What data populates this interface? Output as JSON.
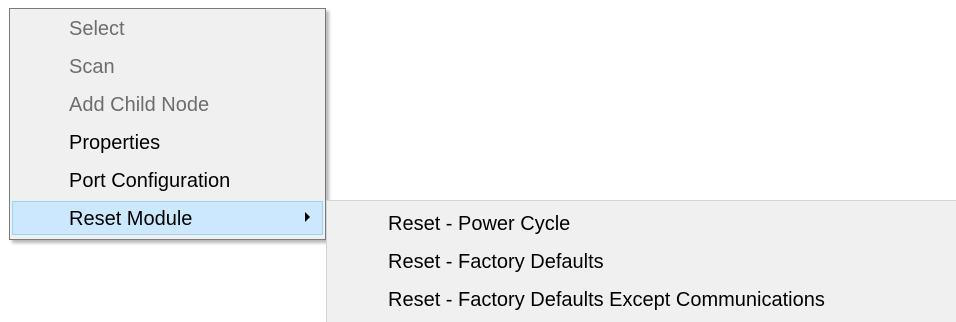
{
  "context_menu": {
    "items": [
      {
        "label": "Select",
        "enabled": false
      },
      {
        "label": "Scan",
        "enabled": false
      },
      {
        "label": "Add Child Node",
        "enabled": false
      },
      {
        "label": "Properties",
        "enabled": true
      },
      {
        "label": "Port Configuration",
        "enabled": true
      },
      {
        "label": "Reset Module",
        "enabled": true,
        "highlighted": true,
        "has_submenu": true
      }
    ],
    "submenu_arrow_icon": "chevron-right-icon"
  },
  "submenu": {
    "items": [
      {
        "label": "Reset - Power Cycle"
      },
      {
        "label": "Reset - Factory Defaults"
      },
      {
        "label": "Reset - Factory Defaults Except Communications"
      }
    ]
  },
  "colors": {
    "menu_background": "#f0f0f0",
    "highlight_background": "#cce8ff",
    "highlight_border": "#99d1ff",
    "disabled_text": "#6d6d6d",
    "text": "#000000"
  }
}
